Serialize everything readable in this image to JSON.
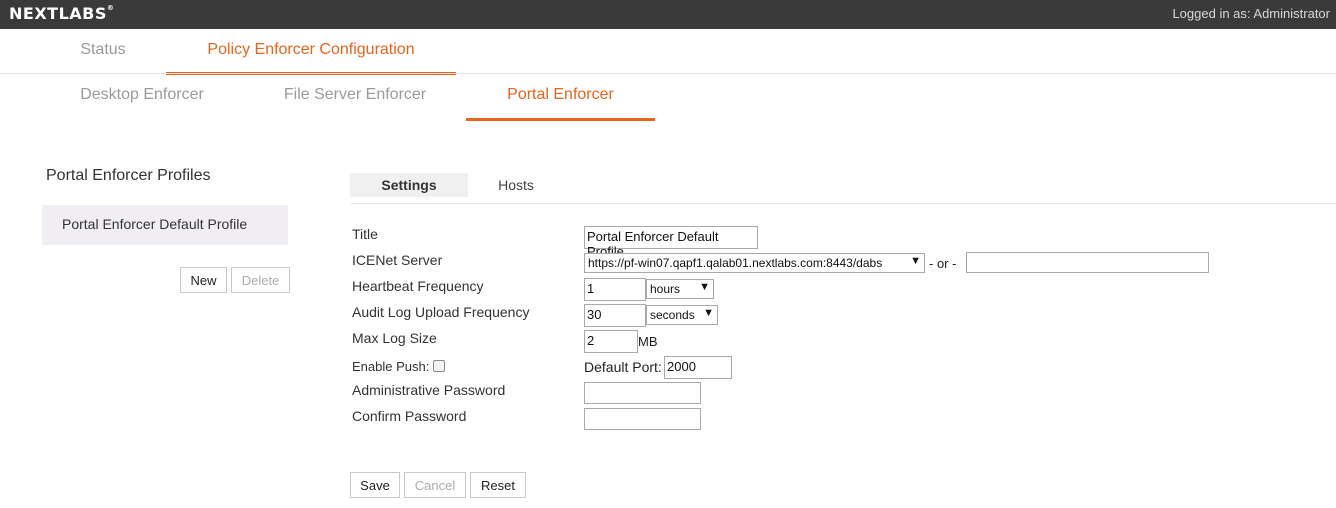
{
  "header": {
    "logo": "NEXTLABS",
    "logo_mark": "®",
    "login_text": "Logged in as: Administrator"
  },
  "main_tabs": [
    {
      "label": "Status",
      "active": false
    },
    {
      "label": "Policy Enforcer Configuration",
      "active": true
    }
  ],
  "sub_tabs": [
    {
      "label": "Desktop Enforcer",
      "active": false
    },
    {
      "label": "File Server Enforcer",
      "active": false
    },
    {
      "label": "Portal Enforcer",
      "active": true
    }
  ],
  "profiles": {
    "title": "Portal Enforcer Profiles",
    "items": [
      {
        "label": "Portal Enforcer Default Profile",
        "selected": true
      }
    ],
    "new_label": "New",
    "delete_label": "Delete"
  },
  "panel_tabs": [
    {
      "label": "Settings",
      "active": true
    },
    {
      "label": "Hosts",
      "active": false
    }
  ],
  "form": {
    "title": {
      "label": "Title",
      "value": "Portal Enforcer Default Profile"
    },
    "icenet": {
      "label": "ICENet Server",
      "selected": "https://pf-win07.qapf1.qalab01.nextlabs.com:8443/dabs",
      "or_text": "- or -",
      "alt_value": ""
    },
    "heartbeat": {
      "label": "Heartbeat Frequency",
      "value": "1",
      "unit": "hours"
    },
    "audit": {
      "label": "Audit Log Upload Frequency",
      "value": "30",
      "unit": "seconds"
    },
    "maxlog": {
      "label": "Max Log Size",
      "value": "2",
      "unit": "MB"
    },
    "push": {
      "label": "Enable Push:",
      "checked": false,
      "port_label": "Default Port:",
      "port_value": "2000"
    },
    "admin_password": {
      "label": "Administrative Password",
      "value": ""
    },
    "confirm_password": {
      "label": "Confirm Password",
      "value": ""
    }
  },
  "actions": {
    "save": "Save",
    "cancel": "Cancel",
    "reset": "Reset"
  },
  "colors": {
    "accent": "#e8641b",
    "topbar": "#3a3a3a"
  }
}
